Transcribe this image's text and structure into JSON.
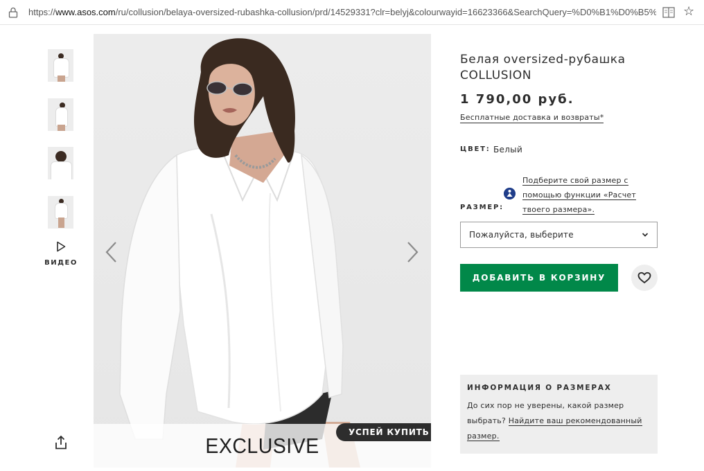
{
  "browser": {
    "url_prefix": "https://",
    "url_domain": "www.asos.com",
    "url_path": "/ru/collusion/belaya-oversized-rubashka-collusion/prd/14529331?clr=belyj&colourwayid=16623366&SearchQuery=%D0%B1%D0%B5%"
  },
  "product": {
    "title": "Белая oversized-рубашка COLLUSION",
    "price": "1 790,00 руб.",
    "delivery_link": "Бесплатные доставка и возвраты*",
    "colour_label": "ЦВЕТ:",
    "colour_value": "Белый",
    "fit_link": "Подберите свой размер с помощью функции «Расчет твоего размера».",
    "size_label": "РАЗМЕР:",
    "size_placeholder": "Пожалуйста, выберите",
    "add_to_bag": "ДОБАВИТЬ В КОРЗИНУ"
  },
  "gallery": {
    "video_label": "ВИДЕО",
    "exclusive_label": "EXCLUSIVE",
    "hurry_badge": "УСПЕЙ КУПИТЬ"
  },
  "size_info": {
    "heading": "ИНФОРМАЦИЯ О РАЗМЕРАХ",
    "text": "До сих пор не уверены, какой размер выбрать?",
    "link": "Найдите ваш рекомендованный размер."
  },
  "icons": {
    "lock": "lock-icon",
    "reader": "reader-view-icon",
    "star": "bookmark-star-icon",
    "play": "play-icon",
    "share": "share-icon",
    "prev": "chevron-left-icon",
    "next": "chevron-right-icon",
    "dropdown": "chevron-down-icon",
    "heart": "heart-icon",
    "fit": "fit-assistant-icon"
  },
  "colors": {
    "accent_green": "#018849",
    "text_dark": "#2d2d2d",
    "panel_grey": "#eeeeee",
    "fit_icon_blue": "#1f3d8a"
  }
}
